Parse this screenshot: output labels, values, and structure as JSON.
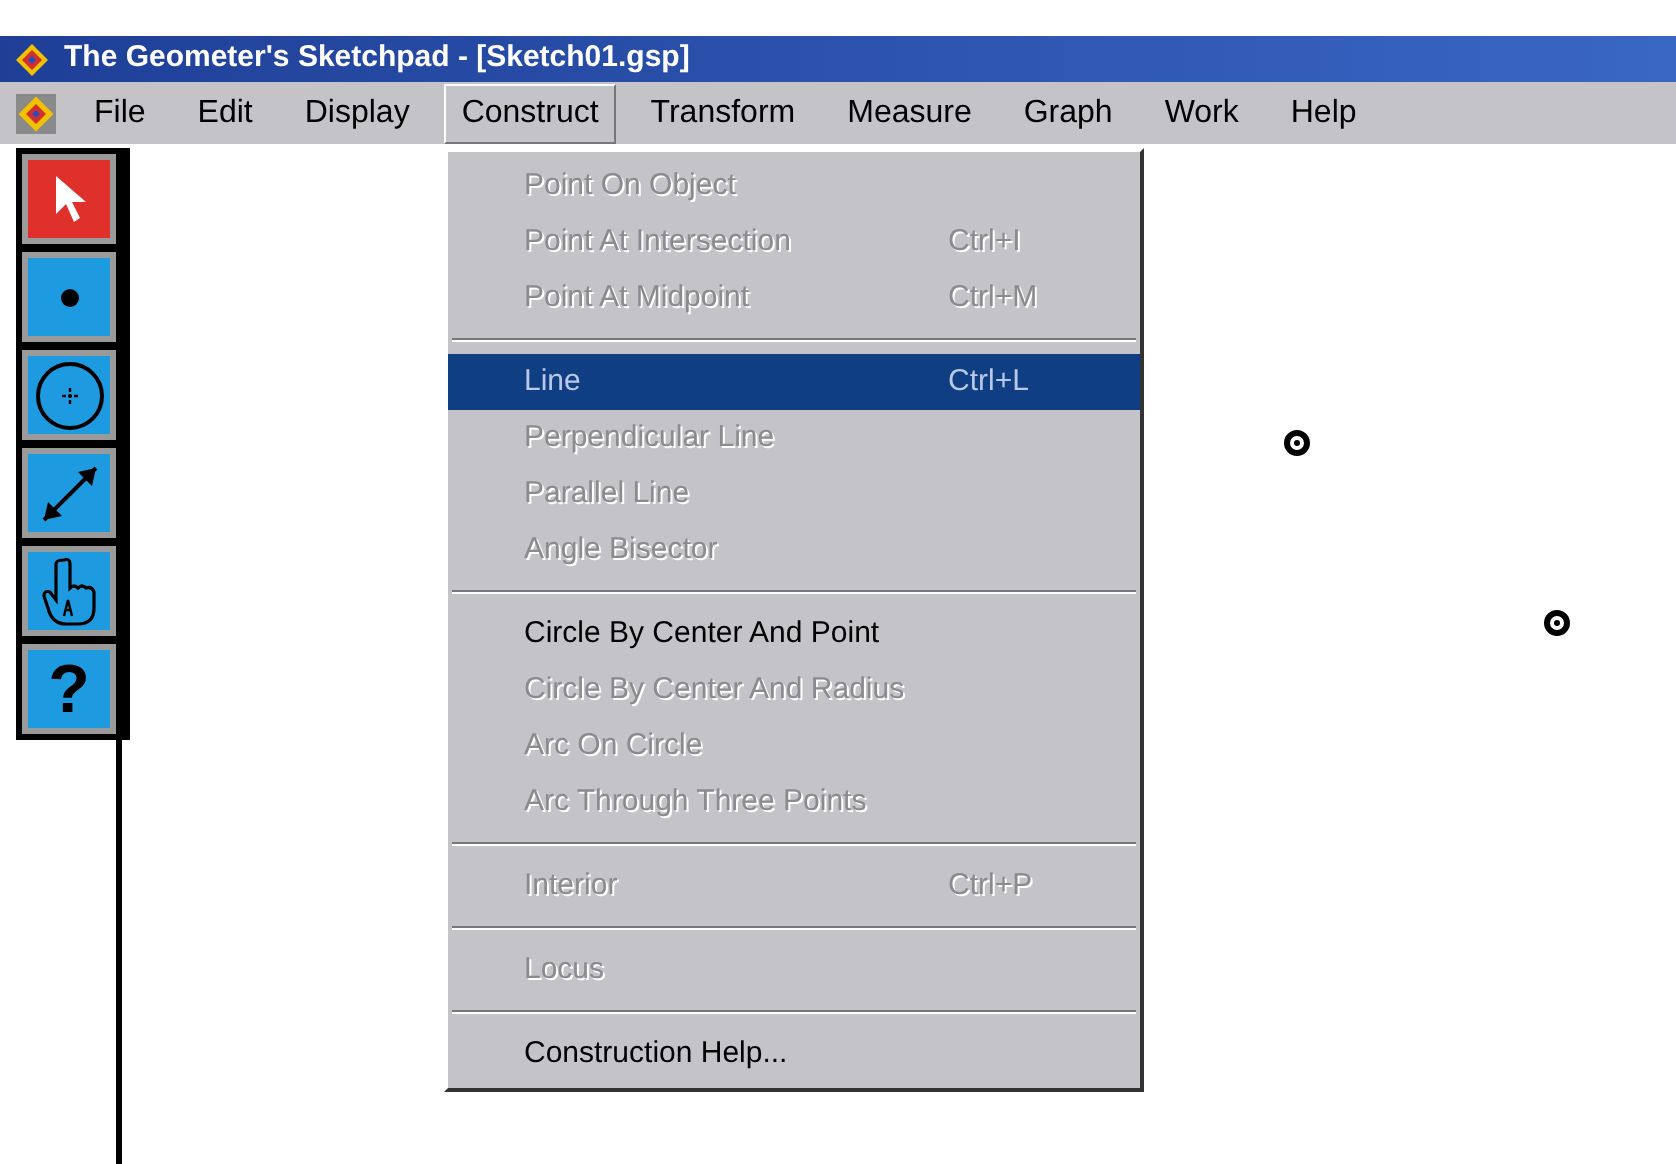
{
  "window": {
    "title": "The Geometer's Sketchpad - [Sketch01.gsp]"
  },
  "menu_bar": [
    {
      "label": "File",
      "selected": false
    },
    {
      "label": "Edit",
      "selected": false
    },
    {
      "label": "Display",
      "selected": false
    },
    {
      "label": "Construct",
      "selected": true
    },
    {
      "label": "Transform",
      "selected": false
    },
    {
      "label": "Measure",
      "selected": false
    },
    {
      "label": "Graph",
      "selected": false
    },
    {
      "label": "Work",
      "selected": false
    },
    {
      "label": "Help",
      "selected": false
    }
  ],
  "toolbox": [
    {
      "kind": "arrow",
      "selected": true
    },
    {
      "kind": "point",
      "selected": false
    },
    {
      "kind": "compass",
      "selected": false
    },
    {
      "kind": "line",
      "selected": false
    },
    {
      "kind": "hand",
      "selected": false
    },
    {
      "kind": "help",
      "label": "?",
      "selected": false
    }
  ],
  "construct_menu": [
    {
      "kind": "item",
      "label": "Point On Object",
      "disabled": true,
      "selected": false
    },
    {
      "kind": "item",
      "label": "Point At Intersection",
      "shortcut": "Ctrl+I",
      "disabled": true,
      "selected": false
    },
    {
      "kind": "item",
      "label": "Point At Midpoint",
      "shortcut": "Ctrl+M",
      "disabled": true,
      "selected": false
    },
    {
      "kind": "separator"
    },
    {
      "kind": "item",
      "label": "Line",
      "shortcut": "Ctrl+L",
      "disabled": true,
      "selected": true
    },
    {
      "kind": "item",
      "label": "Perpendicular Line",
      "disabled": true,
      "selected": false
    },
    {
      "kind": "item",
      "label": "Parallel Line",
      "disabled": true,
      "selected": false
    },
    {
      "kind": "item",
      "label": "Angle Bisector",
      "disabled": true,
      "selected": false
    },
    {
      "kind": "separator"
    },
    {
      "kind": "item",
      "label": "Circle By Center And Point",
      "disabled": false,
      "selected": false
    },
    {
      "kind": "item",
      "label": "Circle By Center And Radius",
      "disabled": true,
      "selected": false
    },
    {
      "kind": "item",
      "label": "Arc On Circle",
      "disabled": true,
      "selected": false
    },
    {
      "kind": "item",
      "label": "Arc Through Three Points",
      "disabled": true,
      "selected": false
    },
    {
      "kind": "separator"
    },
    {
      "kind": "item",
      "label": "Interior",
      "shortcut": "Ctrl+P",
      "disabled": true,
      "selected": false
    },
    {
      "kind": "separator"
    },
    {
      "kind": "item",
      "label": "Locus",
      "disabled": true,
      "selected": false
    },
    {
      "kind": "separator"
    },
    {
      "kind": "item",
      "label": "Construction Help...",
      "disabled": false,
      "selected": false
    }
  ],
  "canvas": {
    "points": [
      {
        "kind": "point"
      },
      {
        "kind": "point"
      }
    ]
  }
}
